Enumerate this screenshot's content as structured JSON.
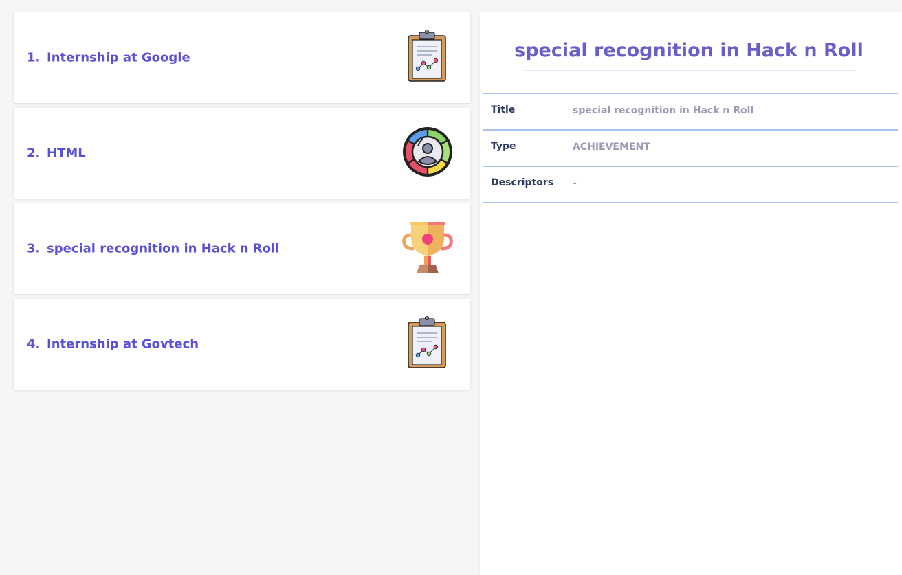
{
  "list": {
    "items": [
      {
        "index": "1.",
        "title": "Internship at Google",
        "icon": "clipboard-chart-icon"
      },
      {
        "index": "2.",
        "title": "HTML",
        "icon": "profile-wheel-icon"
      },
      {
        "index": "3.",
        "title": "special recognition in Hack n Roll",
        "icon": "trophy-icon"
      },
      {
        "index": "4.",
        "title": "Internship at Govtech",
        "icon": "clipboard-chart-icon"
      }
    ]
  },
  "detail": {
    "heading": "special recognition in Hack n Roll",
    "fields": [
      {
        "label": "Title",
        "value": "special recognition in Hack n Roll"
      },
      {
        "label": "Type",
        "value": "ACHIEVEMENT"
      },
      {
        "label": "Descriptors",
        "value": "-"
      }
    ]
  },
  "colors": {
    "accent": "#5a4fd6",
    "heading": "#6a5fc9",
    "divider": "#a9c1ee",
    "label": "#2e3a5c",
    "value": "#9a9ab5"
  }
}
